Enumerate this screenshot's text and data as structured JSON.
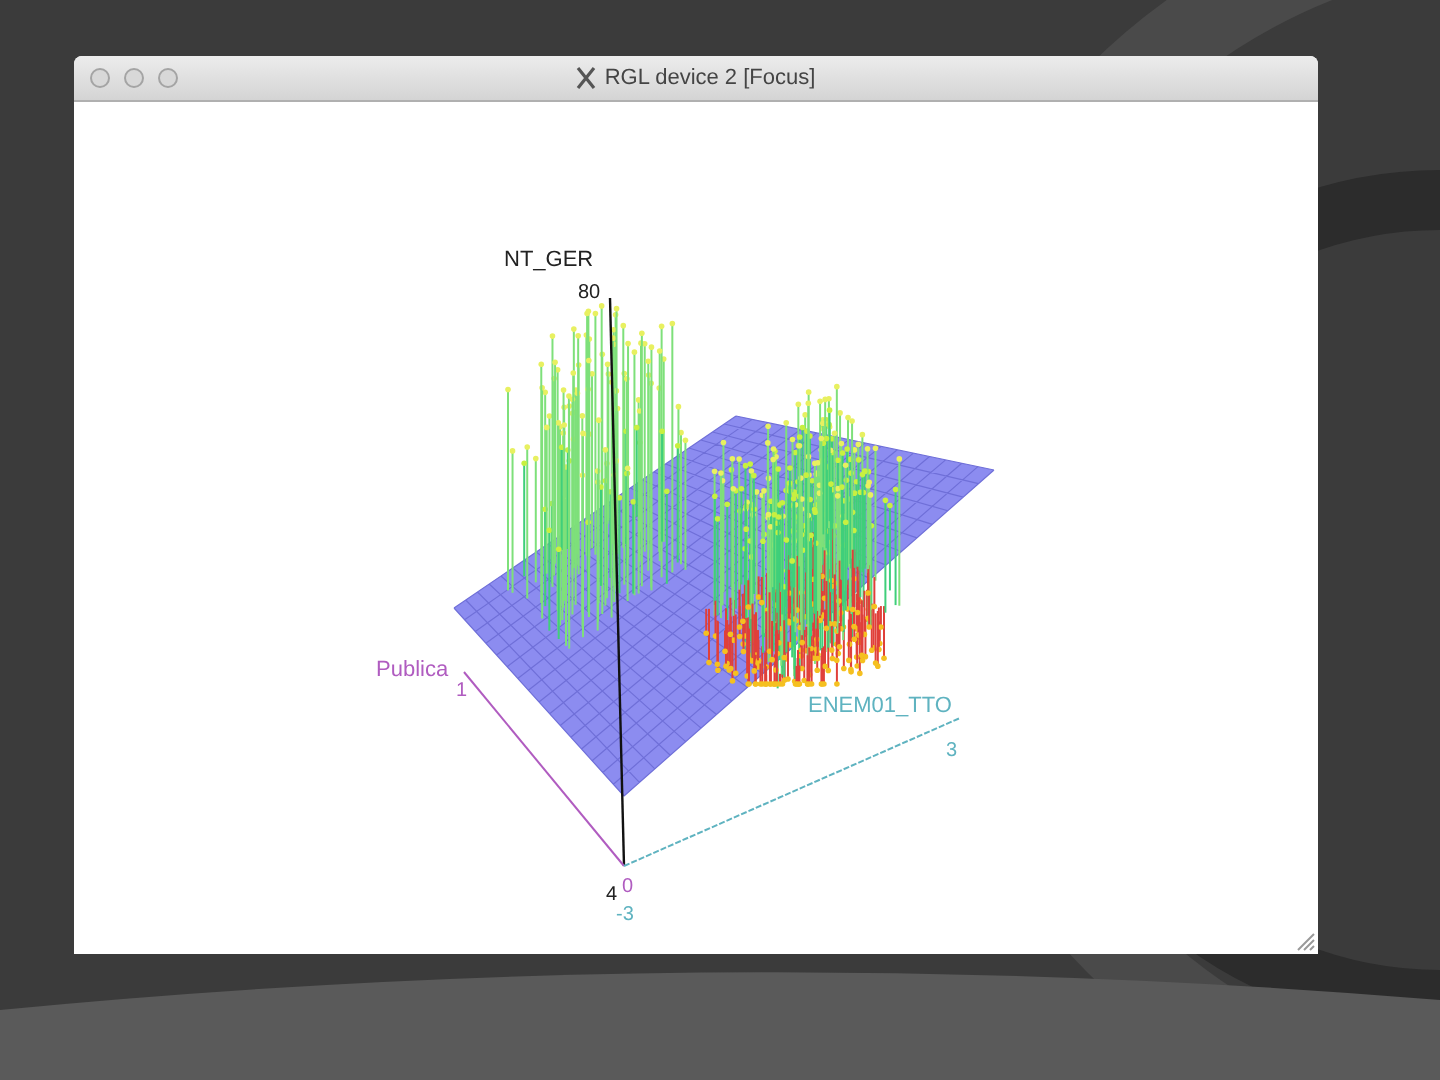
{
  "window": {
    "title": "RGL device 2 [Focus]"
  },
  "plot": {
    "axes": [
      {
        "kind": "z",
        "label": "NT_GER",
        "ticks": [
          "80",
          "4"
        ]
      },
      {
        "kind": "x",
        "label": "Publica",
        "ticks": [
          "1",
          "0"
        ]
      },
      {
        "kind": "y",
        "label": "ENEM01_TTO",
        "ticks": [
          "3",
          "-3"
        ]
      }
    ]
  }
}
